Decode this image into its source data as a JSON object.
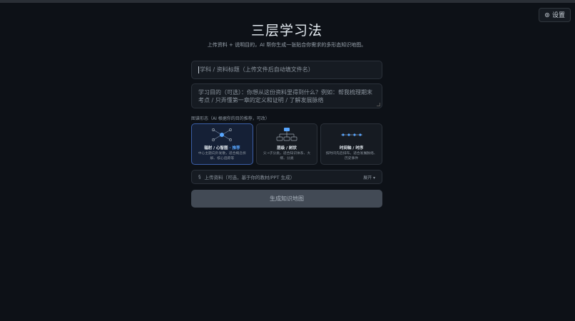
{
  "header": {
    "settings_label": "设置"
  },
  "main": {
    "title": "三层学习法",
    "subtitle": "上传资料 + 说明目的，AI 帮你生成一张贴合你需求的多形态知识地图。",
    "title_input_placeholder": "学科 / 资料标题（上传文件后自动填文件名）",
    "purpose_placeholder": "学习目的（可选）：你想从这份资料里得到什么？例如：帮我梳理期末考点 / 只弄懂第一章的定义和证明 / 了解发展脉络",
    "map_form_label": "图谱形态（AI 根据你的目的推荐，可改）",
    "cards": [
      {
        "title": "辐射 / 心智图",
        "badge": " · 推荐",
        "desc": "中心主题向外发散，适合概念拆解、核心追踪等",
        "icon": "radial-map-icon",
        "selected": true
      },
      {
        "title": "层级 / 树状",
        "badge": "",
        "desc": "父→子分类，适合知识体系、大纲、分类",
        "icon": "tree-map-icon",
        "selected": false
      },
      {
        "title": "时间轴 / 时序",
        "badge": "",
        "desc": "按时间先后排布，适合发展脉络、历史事件",
        "icon": "timeline-icon",
        "selected": false
      }
    ],
    "upload_label": "上传资料（可选，基于你的教材/PPT 生成）",
    "upload_expand": "展开 ▾",
    "generate_label": "生成知识地图"
  },
  "colors": {
    "background": "#0d1117",
    "accent": "#58a6ff",
    "selected_card": "#152036"
  }
}
